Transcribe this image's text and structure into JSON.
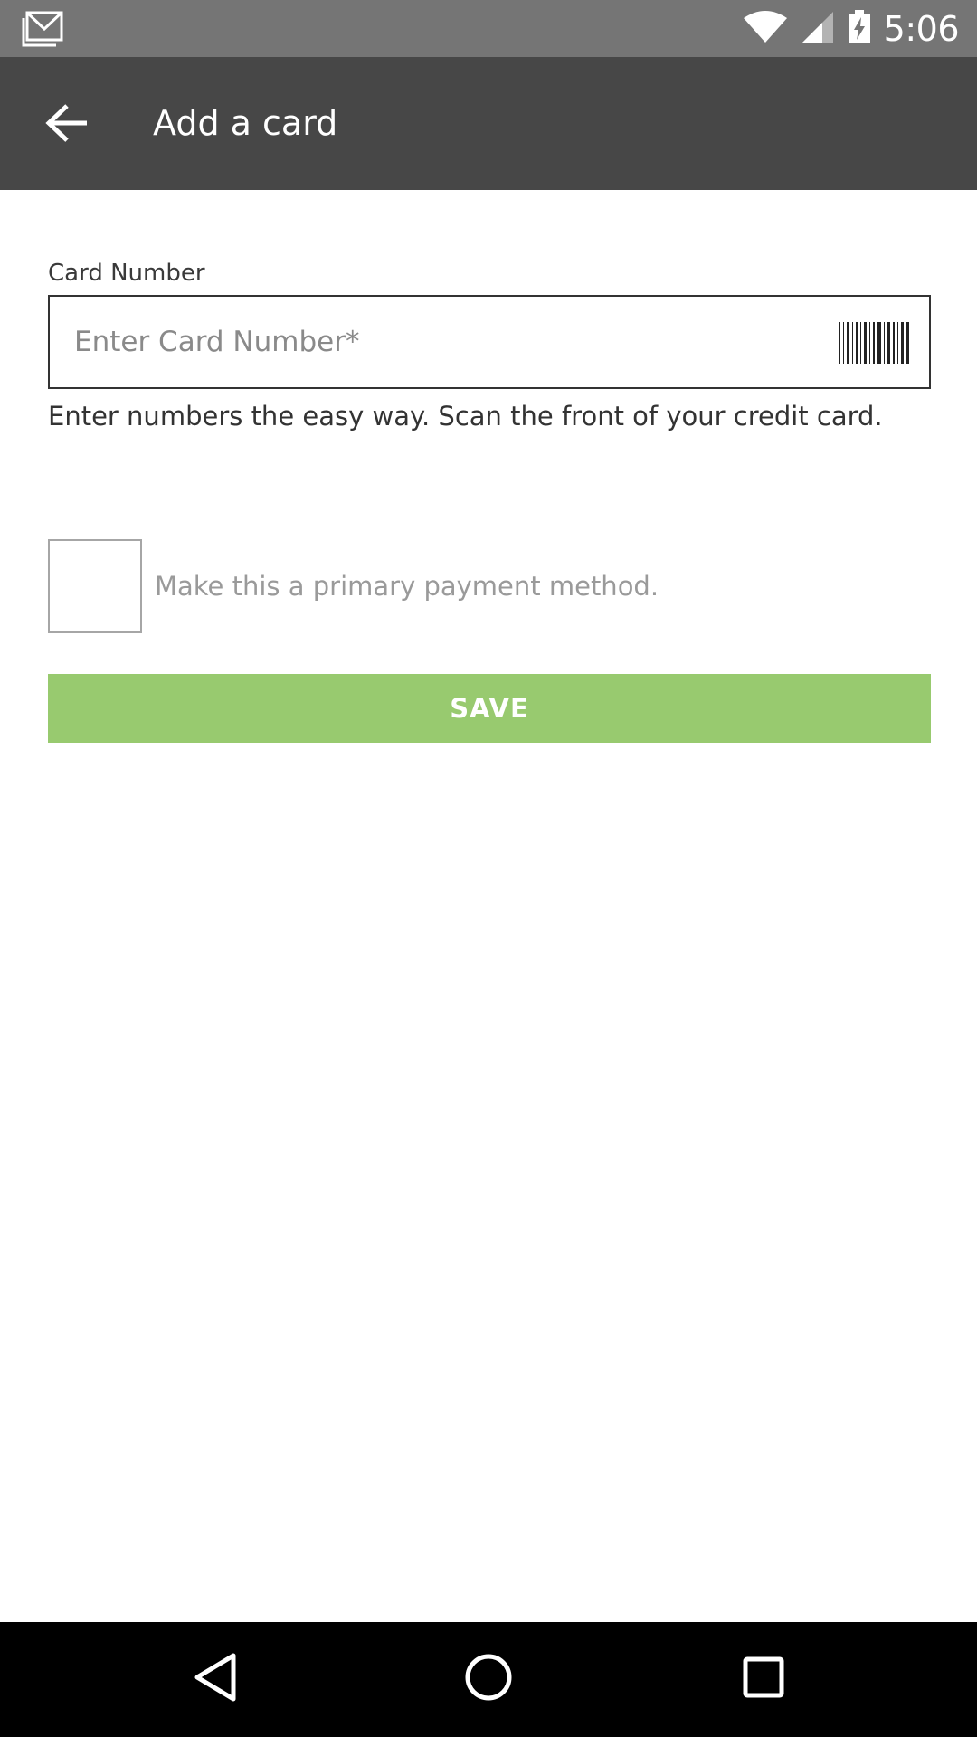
{
  "status_bar": {
    "time": "5:06",
    "icons": [
      "gmail-icon",
      "wifi-icon",
      "signal-icon",
      "battery-charging-icon"
    ]
  },
  "app_bar": {
    "title": "Add a card",
    "back_icon": "arrow-back-icon"
  },
  "form": {
    "card_number_label": "Card Number",
    "card_number_placeholder": "Enter Card Number*",
    "card_number_value": "",
    "scan_icon": "barcode-icon",
    "helper_text": "Enter numbers the easy way. Scan the front of your credit card.",
    "primary_label": "Make this a primary payment method.",
    "primary_checked": false,
    "save_label": "SAVE"
  },
  "nav_bar": {
    "icons": [
      "back-triangle-icon",
      "home-circle-icon",
      "recents-square-icon"
    ]
  },
  "colors": {
    "status_bar": "#757575",
    "app_bar": "#474747",
    "save_button": "#98ca6f",
    "nav_bar": "#000000"
  }
}
